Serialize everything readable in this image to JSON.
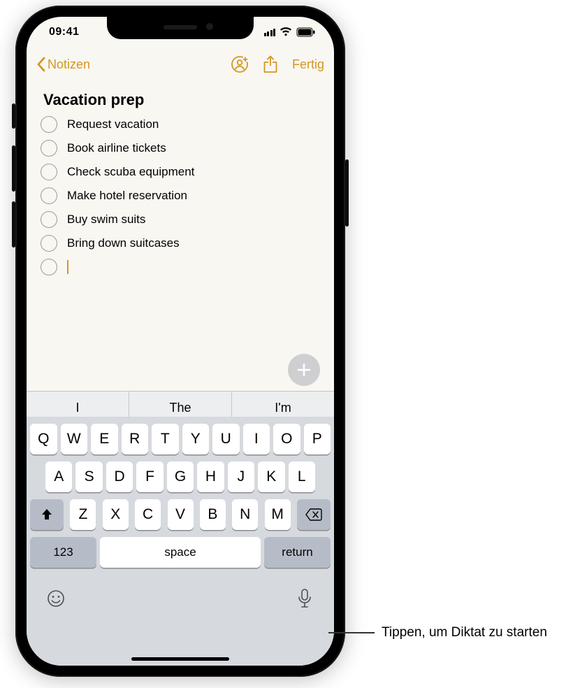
{
  "status": {
    "time": "09:41"
  },
  "nav": {
    "back_label": "Notizen",
    "done_label": "Fertig"
  },
  "note": {
    "title": "Vacation prep",
    "items": [
      "Request vacation",
      "Book airline tickets",
      "Check scuba equipment",
      "Make hotel reservation",
      "Buy swim suits",
      "Bring down suitcases"
    ]
  },
  "keyboard": {
    "predictions": [
      "I",
      "The",
      "I'm"
    ],
    "row1": [
      "Q",
      "W",
      "E",
      "R",
      "T",
      "Y",
      "U",
      "I",
      "O",
      "P"
    ],
    "row2": [
      "A",
      "S",
      "D",
      "F",
      "G",
      "H",
      "J",
      "K",
      "L"
    ],
    "row3": [
      "Z",
      "X",
      "C",
      "V",
      "B",
      "N",
      "M"
    ],
    "numbers_label": "123",
    "space_label": "space",
    "return_label": "return"
  },
  "callout": {
    "text": "Tippen, um Diktat zu starten"
  },
  "colors": {
    "accent": "#d49622"
  }
}
